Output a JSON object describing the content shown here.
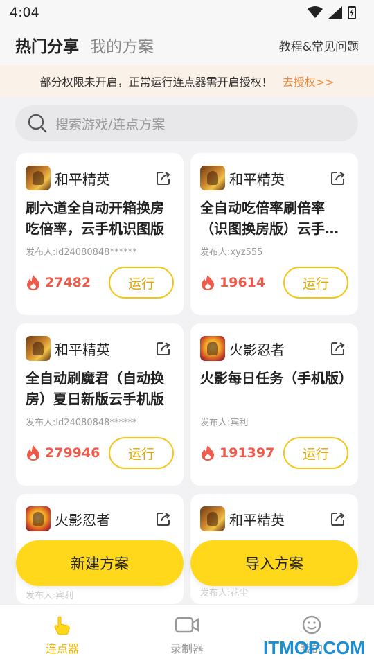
{
  "status_bar": {
    "time": "4:04"
  },
  "header": {
    "tab_active": "热门分享",
    "tab_inactive": "我的方案",
    "help_link": "教程&常见问题"
  },
  "notice": {
    "text": "部分权限未开启，正常运行连点器需开启授权！",
    "link": "去授权>>"
  },
  "search": {
    "placeholder": "搜索游戏/连点方案"
  },
  "cards": [
    {
      "game": "和平精英",
      "title": "刷六道全自动开箱换房吃倍率，云手机识图版",
      "author": "发布人:ld24080848******",
      "heat": "27482",
      "run": "运行"
    },
    {
      "game": "和平精英",
      "title": "全自动吃倍率刷倍率（识图换房版）云手…",
      "author": "发布人:xyz555",
      "heat": "19614",
      "run": "运行"
    },
    {
      "game": "和平精英",
      "title": "全自动刷魔君（自动换房）夏日新版云手机版",
      "author": "发布人:ld24080848******",
      "heat": "279946",
      "run": "运行"
    },
    {
      "game": "火影忍者",
      "title": "火影每日任务（手机版）",
      "author": "发布人:宾利",
      "heat": "191397",
      "run": "运行"
    },
    {
      "game": "火影忍者",
      "title": "",
      "author": "发布人:宾利",
      "heat": "",
      "run": ""
    },
    {
      "game": "和平精英",
      "title": "",
      "author": "发布人:花尘",
      "heat": "",
      "run": ""
    }
  ],
  "actions": {
    "new_plan": "新建方案",
    "import_plan": "导入方案"
  },
  "bottom_nav": [
    {
      "label": "连点器",
      "icon": "hand-tap-icon",
      "active": true
    },
    {
      "label": "录制器",
      "icon": "video-camera-icon",
      "active": false
    },
    {
      "label": "我的",
      "icon": "smiley-icon",
      "active": false
    }
  ],
  "watermark": "ITMOP.COM",
  "colors": {
    "accent": "#ffd81c",
    "heat": "#f05a4a",
    "notice_link": "#f08a3c",
    "nav_active": "#f0b400"
  }
}
